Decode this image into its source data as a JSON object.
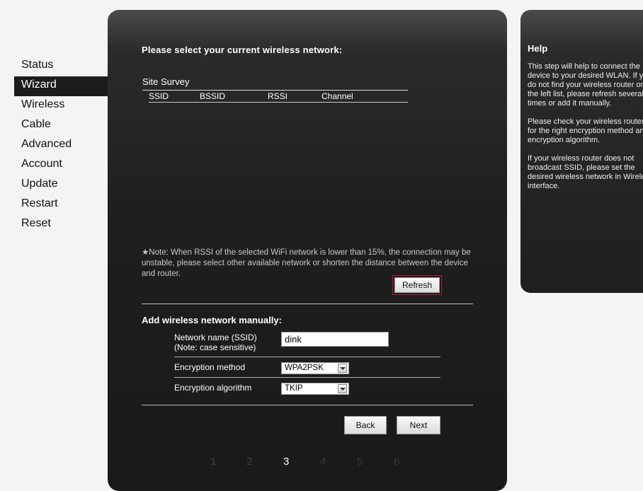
{
  "nav": {
    "items": [
      "Status",
      "Wizard",
      "Wireless",
      "Cable",
      "Advanced",
      "Account",
      "Update",
      "Restart",
      "Reset"
    ],
    "active": "Wizard"
  },
  "main": {
    "heading": "Please select your current wireless network:",
    "survey": {
      "title": "Site Survey",
      "columns": [
        "SSID",
        "BSSID",
        "RSSI",
        "Channel"
      ]
    },
    "note": "★Note: When RSSI of the selected WiFi network is lower than 15%, the connection may be unstable, please select other available network or shorten the distance between the device and router.",
    "refresh_label": "Refresh",
    "manual": {
      "heading": "Add wireless network manually:",
      "ssid_label_1": "Network name (SSID)",
      "ssid_label_2": "(Note: case sensitive)",
      "ssid_value": "dink",
      "enc_method_label": "Encryption method",
      "enc_method_value": "WPA2PSK",
      "enc_alg_label": "Encryption algorithm",
      "enc_alg_value": "TKIP"
    },
    "back_label": "Back",
    "next_label": "Next",
    "steps": [
      "1",
      "2",
      "3",
      "4",
      "5",
      "6"
    ],
    "current_step": "3"
  },
  "help": {
    "title": "Help",
    "paragraphs": [
      "This step will help to connect the device to your desired WLAN. If you do not find your wireless router on the left list, please refresh several times or add it manually.",
      "Please check your wireless router for the right encryption method and encryption algorithm.",
      "If your wireless router does not broadcast SSID, please set the desired wireless network in Wireless interface."
    ]
  }
}
